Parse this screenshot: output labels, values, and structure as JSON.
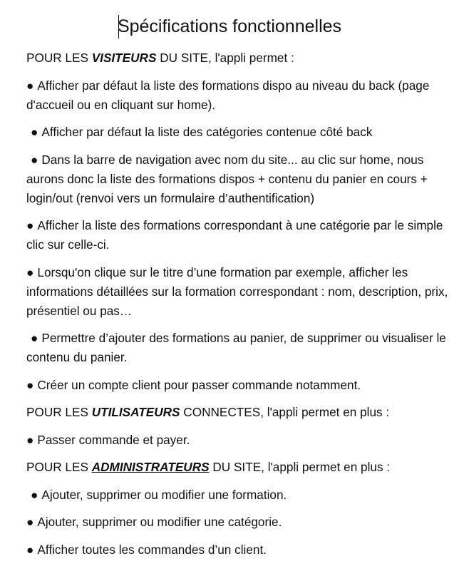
{
  "document": {
    "title": "Spécifications fonctionnelles",
    "bullet": "●",
    "sections": [
      {
        "heading": {
          "prefix": "POUR LES ",
          "emphasis": "VISITEURS",
          "suffix": " DU SITE, l'appli permet :"
        },
        "items": [
          "Afficher par défaut la liste des formations dispo au niveau du back (page d'accueil ou en cliquant sur home).",
          "Afficher par défaut la liste des catégories contenue côté back",
          "Dans la barre de navigation avec nom du site... au clic sur home, nous aurons donc la liste des formations dispos + contenu du panier en cours + login/out (renvoi vers un formulaire d’authentification)",
          "Afficher la liste des formations correspondant à une catégorie par le simple clic sur celle-ci.",
          "Lorsqu'on clique sur le titre d’une formation par exemple, afficher les informations détaillées sur la formation correspondant : nom, description, prix, présentiel ou pas…",
          "Permettre d’ajouter des formations au panier, de supprimer ou visualiser le contenu du panier.",
          "Créer un compte client pour passer commande notamment."
        ]
      },
      {
        "heading": {
          "prefix": "POUR LES ",
          "emphasis": "UTILISATEURS",
          "suffix": " CONNECTES, l'appli permet en plus :"
        },
        "items": [
          "Passer commande et payer."
        ]
      },
      {
        "heading": {
          "prefix": "POUR LES ",
          "emphasis": "ADMINISTRATEURS",
          "suffix": " DU SITE, l'appli permet en plus :"
        },
        "items": [
          "Ajouter, supprimer ou modifier une formation.",
          "Ajouter, supprimer ou modifier une catégorie.",
          "Afficher toutes les commandes d’un client."
        ]
      }
    ]
  }
}
